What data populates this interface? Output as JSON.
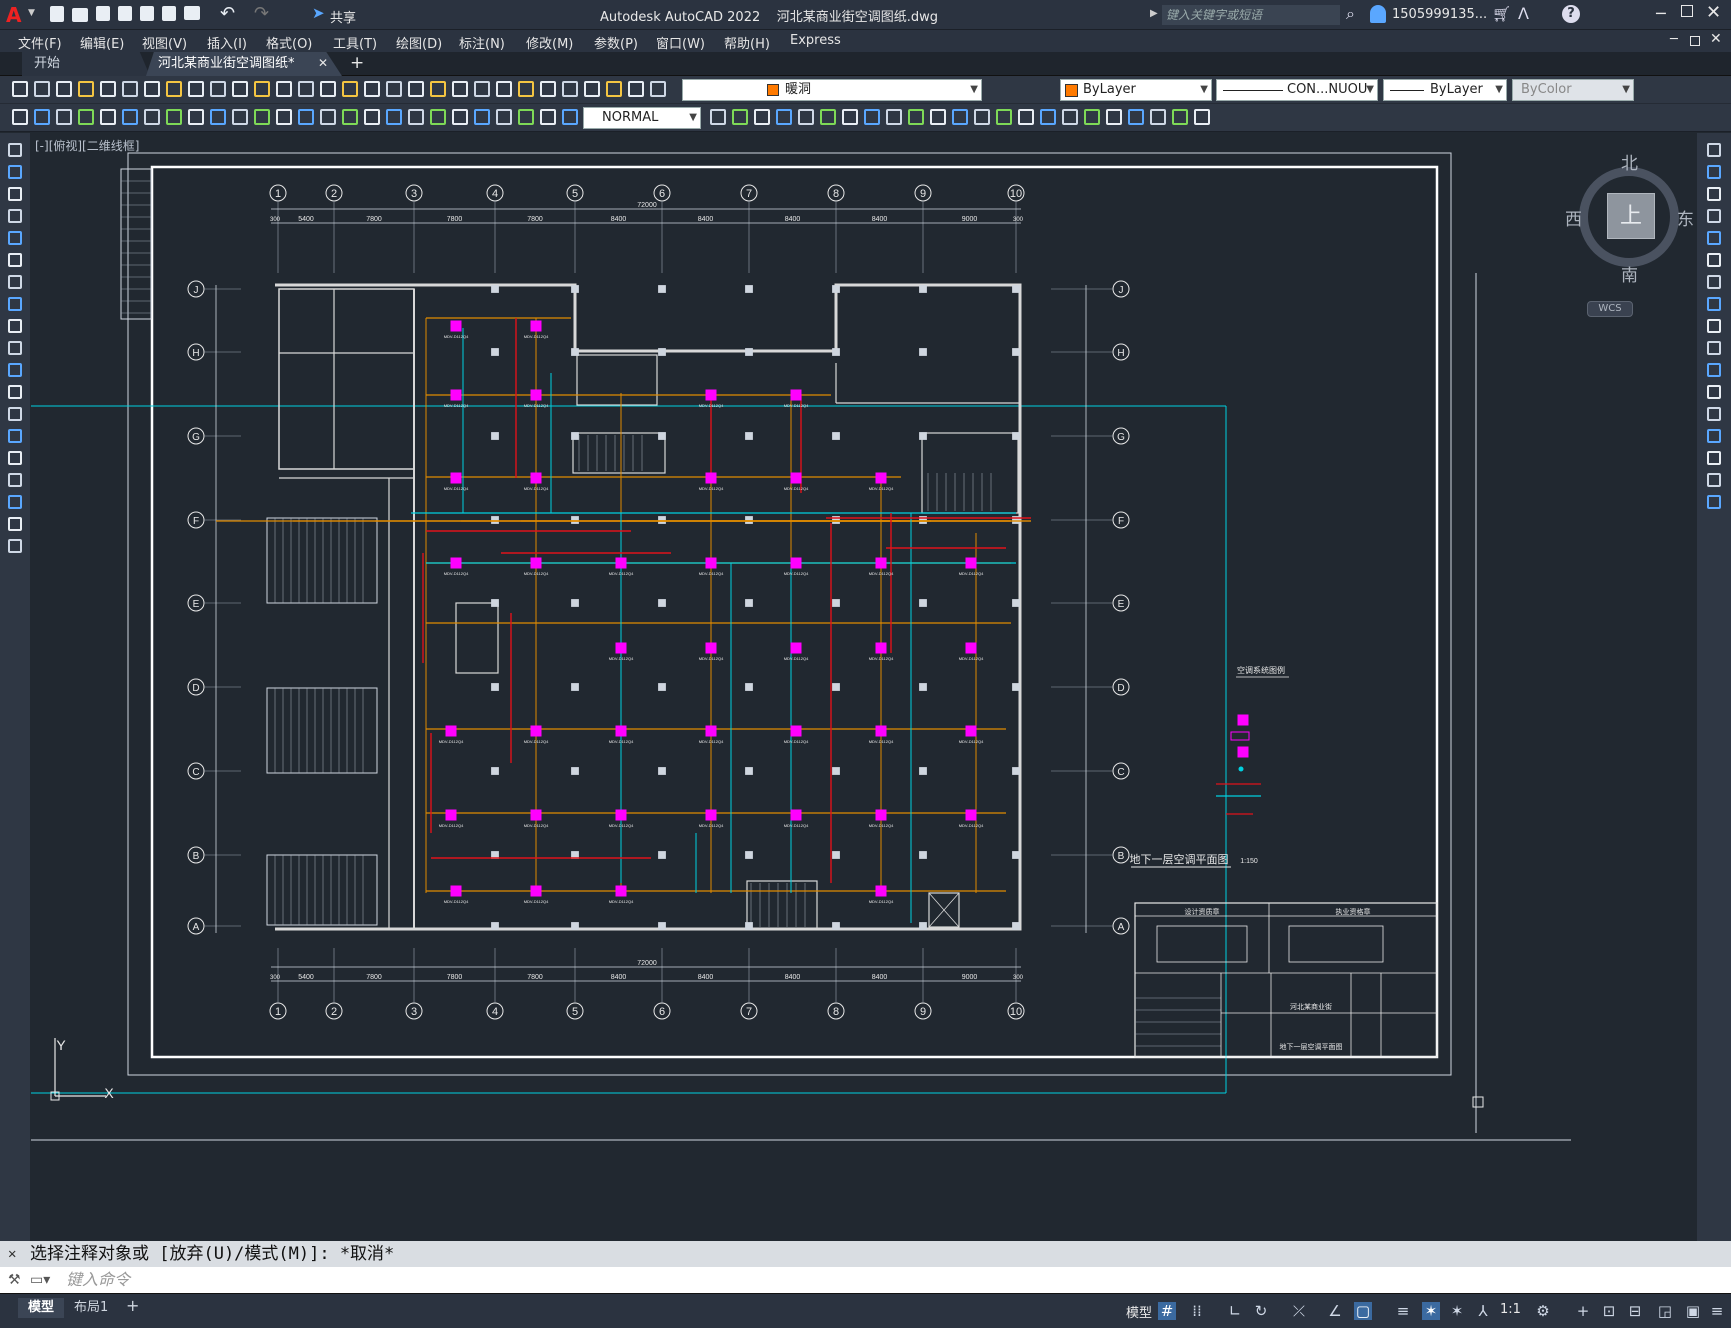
{
  "title": {
    "app": "Autodesk AutoCAD 2022",
    "file": "河北某商业街空调图纸.dwg",
    "search_placeholder": "键入关键字或短语",
    "user": "1505999135...",
    "share": "共享"
  },
  "menu": [
    "文件(F)",
    "编辑(E)",
    "视图(V)",
    "插入(I)",
    "格式(O)",
    "工具(T)",
    "绘图(D)",
    "标注(N)",
    "修改(M)",
    "参数(P)",
    "窗口(W)",
    "帮助(H)",
    "Express"
  ],
  "tabs": {
    "start": "开始",
    "active": "河北某商业街空调图纸*"
  },
  "toolbar": {
    "layer": "暖洞",
    "color": "ByLayer",
    "linetype": "CON...NUOU",
    "lineweight": "ByLayer",
    "plotstyle": "ByColor",
    "dimstyle": "NORMAL"
  },
  "viewport_label": "[-][俯视][二维线框]",
  "viewcube": {
    "north": "北",
    "south": "南",
    "east": "东",
    "west": "西",
    "top": "上",
    "wcs": "WCS"
  },
  "drawing": {
    "col_axes": [
      "1",
      "2",
      "3",
      "4",
      "5",
      "6",
      "7",
      "8",
      "9",
      "10"
    ],
    "row_axes": [
      "J",
      "H",
      "G",
      "F",
      "E",
      "D",
      "C",
      "B",
      "A"
    ],
    "dims": [
      "5400",
      "7800",
      "7800",
      "7800",
      "8400",
      "8400",
      "8400",
      "8400",
      "9000"
    ],
    "total_dim": "72000",
    "end_dim": "300",
    "title_text": "地下一层空调平面图",
    "scale_text": "1:150",
    "legend_title": "空调系统图例",
    "unit_label": "MDV-D112Q4",
    "unit_label2": "MDV-BY101A",
    "pipe_label": "Φ28.6/Φ12.7",
    "tb_header1": "设计资质章",
    "tb_header2": "执业资格章",
    "tb_project": "河北某商业街",
    "tb_drawing": "地下一层空调平面图"
  },
  "command": {
    "history": "选择注释对象或 [放弃(U)/模式(M)]: *取消*",
    "placeholder": "键入命令"
  },
  "status": {
    "model_tab": "模型",
    "layout_tab": "布局1",
    "model_label": "模型",
    "scale": "1:1"
  },
  "colors": {
    "accent": "#00d0e0",
    "pipe_red": "#e0121a",
    "pipe_orange": "#e08a00",
    "unit_magenta": "#ff00ff",
    "wall": "#d8d8d8"
  }
}
